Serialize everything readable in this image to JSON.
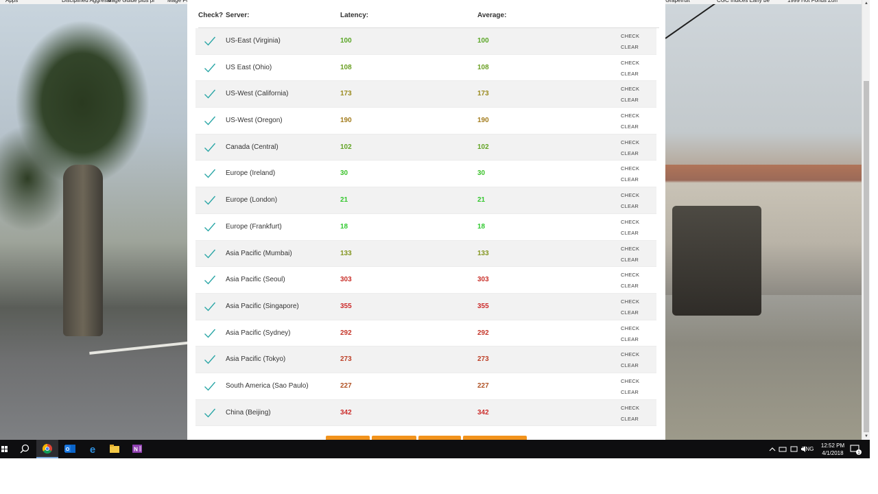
{
  "bookmarks": [
    "Apps",
    "Disciplined Aggressi",
    "Mage Guide plus pr",
    "Mage FC Raid DPS G",
    "Mish Shuare, Greet",
    "Nostamus Begins",
    "Nostamus Begins",
    "Pix Vecteurs | Illust",
    "Vectorlevel.net | F",
    "Scrimplus: Vector",
    "Solaire Grapefruit",
    "CGC Indices Early be",
    "1999 Hot Fonds Zon"
  ],
  "table": {
    "headers": {
      "check": "Check?",
      "server": "Server:",
      "latency": "Latency:",
      "average": "Average:"
    },
    "check_label": "CHECK",
    "clear_label": "CLEAR",
    "rows": [
      {
        "server": "US-East (Virginia)",
        "latency": "100",
        "average": "100",
        "color": "#5aa626"
      },
      {
        "server": "US East (Ohio)",
        "latency": "108",
        "average": "108",
        "color": "#6a9f22"
      },
      {
        "server": "US-West (California)",
        "latency": "173",
        "average": "173",
        "color": "#9a8a1e"
      },
      {
        "server": "US-West (Oregon)",
        "latency": "190",
        "average": "190",
        "color": "#a37c1d"
      },
      {
        "server": "Canada (Central)",
        "latency": "102",
        "average": "102",
        "color": "#62a424"
      },
      {
        "server": "Europe (Ireland)",
        "latency": "30",
        "average": "30",
        "color": "#3cc22c"
      },
      {
        "server": "Europe (London)",
        "latency": "21",
        "average": "21",
        "color": "#34c72e"
      },
      {
        "server": "Europe (Frankfurt)",
        "latency": "18",
        "average": "18",
        "color": "#30c92f"
      },
      {
        "server": "Asia Pacific (Mumbai)",
        "latency": "133",
        "average": "133",
        "color": "#849621"
      },
      {
        "server": "Asia Pacific (Seoul)",
        "latency": "303",
        "average": "303",
        "color": "#c9302a"
      },
      {
        "server": "Asia Pacific (Singapore)",
        "latency": "355",
        "average": "355",
        "color": "#cc2a2a"
      },
      {
        "server": "Asia Pacific (Sydney)",
        "latency": "292",
        "average": "292",
        "color": "#c5362a"
      },
      {
        "server": "Asia Pacific (Tokyo)",
        "latency": "273",
        "average": "273",
        "color": "#bd4028"
      },
      {
        "server": "South America (Sao Paulo)",
        "latency": "227",
        "average": "227",
        "color": "#b05224"
      },
      {
        "server": "China (Beijing)",
        "latency": "342",
        "average": "342",
        "color": "#cb2c2a"
      }
    ]
  },
  "accent": {
    "check_icon": "#2aa6a6",
    "bottom_buttons": "#f2931c"
  },
  "taskbar": {
    "language": "ENG",
    "time": "12:52 PM",
    "date": "4/1/2018",
    "notification_count": "1"
  }
}
